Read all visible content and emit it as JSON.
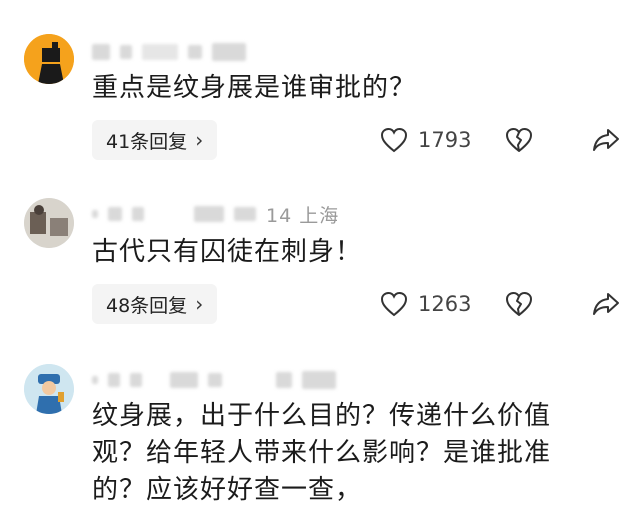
{
  "comments": [
    {
      "meta_suffix": "",
      "text": "重点是纹身展是谁审批的？",
      "reply_label": "41条回复",
      "like_count": "1793"
    },
    {
      "meta_suffix": "14 上海",
      "text": "古代只有囚徒在刺身！",
      "reply_label": "48条回复",
      "like_count": "1263"
    },
    {
      "meta_suffix": "",
      "text_lines": [
        "纹身展，出于什么目的？传递什么价值",
        "观？给年轻人带来什么影响？是谁批准",
        "的？应该好好查一查，"
      ]
    }
  ],
  "icons": {
    "heart": "heart-outline-icon",
    "broken_heart": "broken-heart-icon",
    "share": "share-arrow-icon",
    "chevron": "›"
  },
  "colors": {
    "text": "#1b1b1b",
    "meta": "#9a9a9a",
    "pill": "#f4f4f4"
  }
}
